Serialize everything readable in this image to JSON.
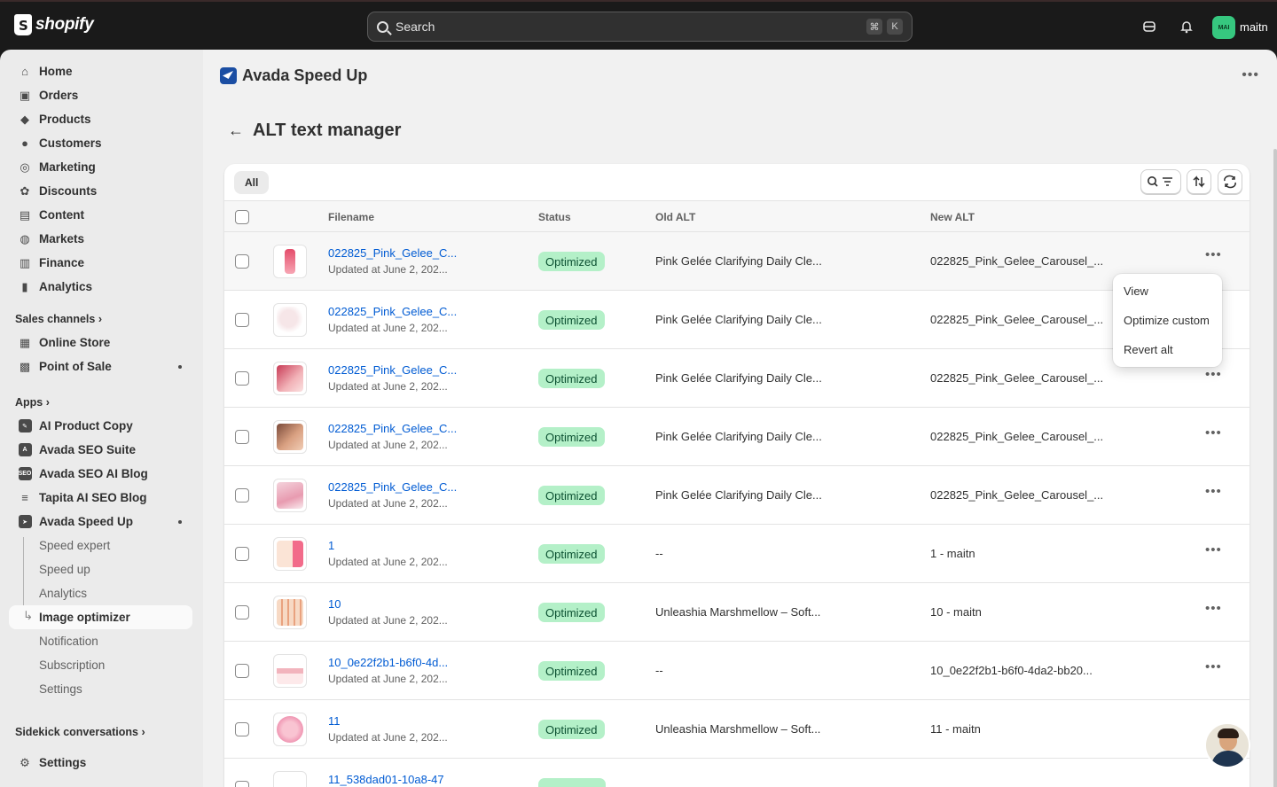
{
  "topbar": {
    "brand": "shopify",
    "search_placeholder": "Search",
    "shortcut_cmd": "⌘",
    "shortcut_key": "K",
    "avatar_initials": "MAI",
    "user_name": "maitn"
  },
  "sidebar": {
    "main_items": [
      {
        "label": "Home",
        "icon": "⌂"
      },
      {
        "label": "Orders",
        "icon": "▣"
      },
      {
        "label": "Products",
        "icon": "◆"
      },
      {
        "label": "Customers",
        "icon": "●"
      },
      {
        "label": "Marketing",
        "icon": "◎"
      },
      {
        "label": "Discounts",
        "icon": "✿"
      },
      {
        "label": "Content",
        "icon": "▤"
      },
      {
        "label": "Markets",
        "icon": "◍"
      },
      {
        "label": "Finance",
        "icon": "▥"
      },
      {
        "label": "Analytics",
        "icon": "▮"
      }
    ],
    "sales_channels_label": "Sales channels",
    "sales_channels": [
      {
        "label": "Online Store"
      },
      {
        "label": "Point of Sale"
      }
    ],
    "apps_label": "Apps",
    "apps": [
      {
        "label": "AI Product Copy"
      },
      {
        "label": "Avada SEO Suite"
      },
      {
        "label": "Avada SEO AI Blog"
      },
      {
        "label": "Tapita AI SEO Blog"
      },
      {
        "label": "Avada Speed Up"
      }
    ],
    "sub_items": [
      {
        "label": "Speed expert"
      },
      {
        "label": "Speed up"
      },
      {
        "label": "Analytics"
      },
      {
        "label": "Image optimizer"
      },
      {
        "label": "Notification"
      },
      {
        "label": "Subscription"
      },
      {
        "label": "Settings"
      }
    ],
    "sidekick_label": "Sidekick conversations",
    "settings_label": "Settings"
  },
  "main": {
    "app_title": "Avada Speed Up",
    "page_title": "ALT text manager",
    "tab_all": "All",
    "columns": {
      "filename": "Filename",
      "status": "Status",
      "old_alt": "Old ALT",
      "new_alt": "New ALT"
    },
    "rows": [
      {
        "filename": "022825_Pink_Gelee_C...",
        "updated": "Updated at June 2, 202...",
        "status": "Optimized",
        "old_alt": "Pink Gelée Clarifying Daily Cle...",
        "new_alt": "022825_Pink_Gelee_Carousel_..."
      },
      {
        "filename": "022825_Pink_Gelee_C...",
        "updated": "Updated at June 2, 202...",
        "status": "Optimized",
        "old_alt": "Pink Gelée Clarifying Daily Cle...",
        "new_alt": "022825_Pink_Gelee_Carousel_..."
      },
      {
        "filename": "022825_Pink_Gelee_C...",
        "updated": "Updated at June 2, 202...",
        "status": "Optimized",
        "old_alt": "Pink Gelée Clarifying Daily Cle...",
        "new_alt": "022825_Pink_Gelee_Carousel_..."
      },
      {
        "filename": "022825_Pink_Gelee_C...",
        "updated": "Updated at June 2, 202...",
        "status": "Optimized",
        "old_alt": "Pink Gelée Clarifying Daily Cle...",
        "new_alt": "022825_Pink_Gelee_Carousel_..."
      },
      {
        "filename": "022825_Pink_Gelee_C...",
        "updated": "Updated at June 2, 202...",
        "status": "Optimized",
        "old_alt": "Pink Gelée Clarifying Daily Cle...",
        "new_alt": "022825_Pink_Gelee_Carousel_..."
      },
      {
        "filename": "1",
        "updated": "Updated at June 2, 202...",
        "status": "Optimized",
        "old_alt": "--",
        "new_alt": "1 - maitn"
      },
      {
        "filename": "10",
        "updated": "Updated at June 2, 202...",
        "status": "Optimized",
        "old_alt": "Unleashia Marshmellow – Soft...",
        "new_alt": "10 - maitn"
      },
      {
        "filename": "10_0e22f2b1-b6f0-4d...",
        "updated": "Updated at June 2, 202...",
        "status": "Optimized",
        "old_alt": "--",
        "new_alt": "10_0e22f2b1-b6f0-4da2-bb20..."
      },
      {
        "filename": "11",
        "updated": "Updated at June 2, 202...",
        "status": "Optimized",
        "old_alt": "Unleashia Marshmellow – Soft...",
        "new_alt": "11 - maitn"
      },
      {
        "filename": "11_538dad01-10a8-47",
        "updated": "",
        "status": "",
        "old_alt": "",
        "new_alt": ""
      }
    ],
    "row_menu": {
      "view": "View",
      "optimize_custom": "Optimize custom",
      "revert_alt": "Revert alt"
    }
  },
  "colors": {
    "accent_link": "#005bd3",
    "badge_bg": "#b4f0c8",
    "badge_text": "#0c5132",
    "avatar_bg": "#36c77f"
  }
}
